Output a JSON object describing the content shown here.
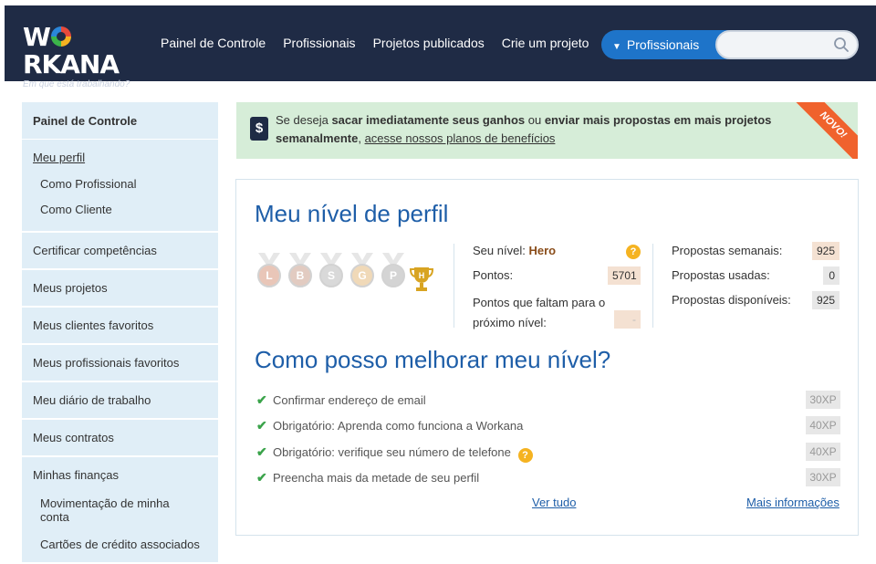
{
  "header": {
    "logo_text_left": "W",
    "logo_text_right": "RKANA",
    "logo_tagline": "Em que está trabalhando?",
    "nav": [
      "Painel de Controle",
      "Profissionais",
      "Projetos publicados",
      "Crie um projeto"
    ],
    "search_type": "Profissionais",
    "search_placeholder": "",
    "colors": {
      "bar": "#1f2b45",
      "search_type": "#1e74c9"
    }
  },
  "sidebar": {
    "title": "Painel de Controle",
    "profile_link": "Meu perfil",
    "profile_sub": [
      "Como Profissional",
      "Como Cliente"
    ],
    "items": [
      "Certificar competências",
      "Meus projetos",
      "Meus clientes favoritos",
      "Meus profissionais favoritos",
      "Meu diário de trabalho",
      "Meus contratos"
    ],
    "finance_title": "Minhas finanças",
    "finance_sub": [
      "Movimentação de minha conta",
      "Cartões de crédito associados"
    ]
  },
  "banner": {
    "icon": "$",
    "text_1": "Se deseja ",
    "bold_1": "sacar imediatamente seus ganhos",
    "text_2": " ou ",
    "bold_2": "enviar mais propostas em mais projetos semanalmente",
    "text_3": ", ",
    "link": "acesse nossos planos de benefícios",
    "ribbon": "NOVO!"
  },
  "level": {
    "title": "Meu nível de perfil",
    "badges": [
      "L",
      "B",
      "S",
      "G",
      "P"
    ],
    "trophy_letter": "H",
    "level_label": "Seu nível:",
    "level_value": "Hero",
    "points_label": "Pontos:",
    "points_value": "5701",
    "remaining_label": "Pontos que faltam para o próximo nível:",
    "remaining_value": "-",
    "weekly_label": "Propostas semanais:",
    "weekly_value": "925",
    "used_label": "Propostas usadas:",
    "used_value": "0",
    "available_label": "Propostas disponíveis:",
    "available_value": "925"
  },
  "improve": {
    "title": "Como posso melhorar meu nível?",
    "tasks": [
      {
        "label": "Confirmar endereço de email",
        "xp": "30XP"
      },
      {
        "label": "Obrigatório: Aprenda como funciona a Workana",
        "xp": "40XP"
      },
      {
        "label": "Obrigatório: verifique seu número de telefone",
        "xp": "40XP"
      },
      {
        "label": "Preencha mais da metade de seu perfil",
        "xp": "30XP"
      }
    ],
    "see_all": "Ver tudo",
    "more_info": "Mais informações"
  }
}
